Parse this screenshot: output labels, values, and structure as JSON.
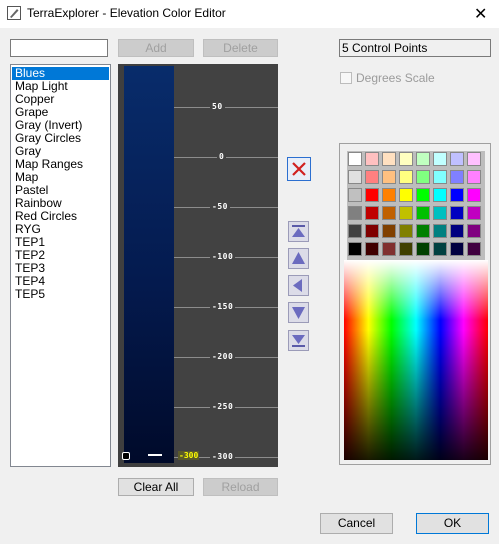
{
  "window": {
    "title": "TerraExplorer - Elevation Color Editor",
    "close_glyph": "✕"
  },
  "toolbar": {
    "name_value": "",
    "add_label": "Add",
    "delete_label": "Delete"
  },
  "info": {
    "control_points": "5 Control Points",
    "degrees_scale_label": "Degrees Scale",
    "degrees_scale_checked": false
  },
  "schemes": {
    "selected": "Blues",
    "items": [
      "Blues",
      "Map Light",
      "Copper",
      "Grape",
      "Gray (Invert)",
      "Gray Circles",
      "Gray",
      "Map Ranges",
      "Map",
      "Pastel",
      "Rainbow",
      "Red Circles",
      "RYG",
      "TEP1",
      "TEP2",
      "TEP3",
      "TEP4",
      "TEP5"
    ]
  },
  "ramp": {
    "ticks": [
      "50",
      "0",
      "-50",
      "-100",
      "-150",
      "-200",
      "-250",
      "-300"
    ],
    "control_point_value": "-300",
    "gradient_colors": [
      "#082c6b",
      "#041a4e",
      "#000a2a"
    ]
  },
  "side_buttons": [
    "delete-point",
    "move-top",
    "move-up",
    "move-left",
    "move-down",
    "move-bottom"
  ],
  "bottom": {
    "clear_all": "Clear All",
    "reload": "Reload",
    "cancel": "Cancel",
    "ok": "OK"
  },
  "palette": {
    "rows": [
      [
        "#ffffff",
        "#ffc0c0",
        "#ffe0c0",
        "#ffffc0",
        "#c0ffc0",
        "#c0ffff",
        "#c0c0ff",
        "#ffc0ff"
      ],
      [
        "#e0e0e0",
        "#ff8080",
        "#ffc080",
        "#ffff80",
        "#80ff80",
        "#80ffff",
        "#8080ff",
        "#ff80ff"
      ],
      [
        "#c0c0c0",
        "#ff0000",
        "#ff8000",
        "#ffff00",
        "#00ff00",
        "#00ffff",
        "#0000ff",
        "#ff00ff"
      ],
      [
        "#808080",
        "#c00000",
        "#c06000",
        "#c0c000",
        "#00c000",
        "#00c0c0",
        "#0000c0",
        "#c000c0"
      ],
      [
        "#404040",
        "#800000",
        "#804000",
        "#808000",
        "#008000",
        "#008080",
        "#000080",
        "#800080"
      ],
      [
        "#000000",
        "#400000",
        "#803030",
        "#404000",
        "#004000",
        "#004040",
        "#000040",
        "#400040"
      ]
    ]
  }
}
